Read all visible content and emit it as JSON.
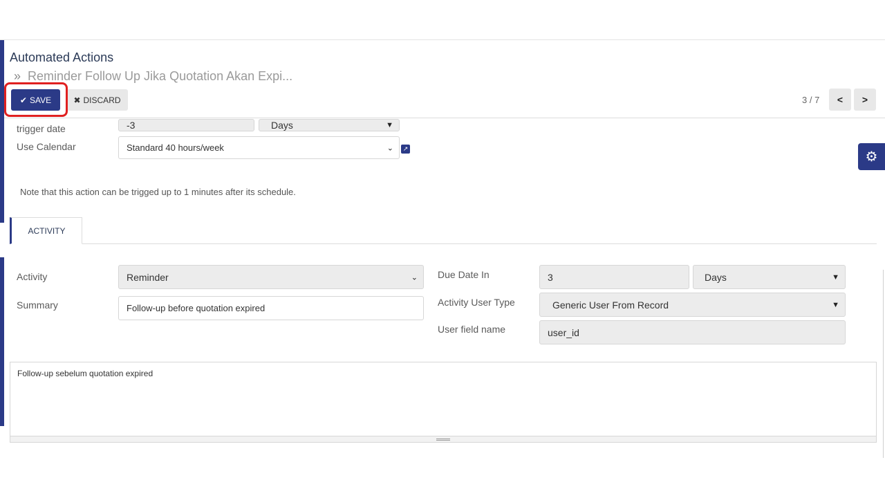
{
  "breadcrumb": {
    "root": "Automated Actions",
    "separator": "»",
    "current": "Reminder Follow Up Jika Quotation Akan Expi..."
  },
  "toolbar": {
    "save_label": "SAVE",
    "discard_label": "DISCARD"
  },
  "pager": {
    "text": "3 / 7"
  },
  "trigger": {
    "label_partial": "trigger date",
    "delay_value": "-3",
    "delay_unit": "Days"
  },
  "calendar": {
    "label": "Use Calendar",
    "value": "Standard 40 hours/week"
  },
  "note": "Note that this action can be trigged up to 1 minutes after its schedule.",
  "tabs": [
    {
      "label": "ACTIVITY"
    }
  ],
  "activity": {
    "activity_label": "Activity",
    "activity_value": "Reminder",
    "summary_label": "Summary",
    "summary_value": "Follow-up before quotation expired",
    "due_label": "Due Date In",
    "due_value": "3",
    "due_unit": "Days",
    "user_type_label": "Activity User Type",
    "user_type_value": "Generic User From Record",
    "user_field_label": "User field name",
    "user_field_value": "user_id"
  },
  "note_body": "Follow-up sebelum quotation expired",
  "icons": {
    "save": "check-icon",
    "discard": "x-icon",
    "prev": "chevron-left-icon",
    "next": "chevron-right-icon",
    "external": "external-link-icon",
    "settings": "gear-icon",
    "dropdown": "chevron-down-icon"
  },
  "colors": {
    "primary": "#2b3a87",
    "highlight": "#e02020",
    "field_grey": "#ececec"
  }
}
